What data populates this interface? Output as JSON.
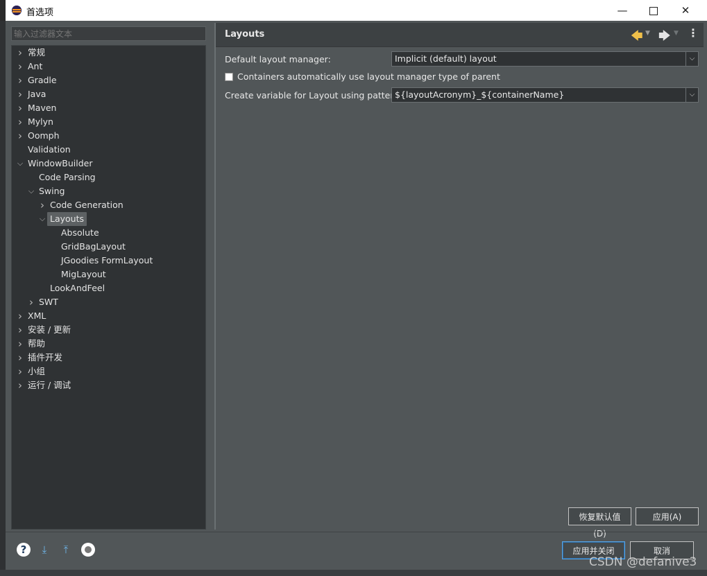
{
  "window": {
    "title": "首选项",
    "minimize_glyph": "—",
    "close_glyph": "✕"
  },
  "filter": {
    "placeholder": "输入过滤器文本"
  },
  "tree": {
    "items": [
      {
        "label": "常规",
        "expander": "collapsed",
        "depth": 0
      },
      {
        "label": "Ant",
        "expander": "collapsed",
        "depth": 0
      },
      {
        "label": "Gradle",
        "expander": "collapsed",
        "depth": 0
      },
      {
        "label": "Java",
        "expander": "collapsed",
        "depth": 0
      },
      {
        "label": "Maven",
        "expander": "collapsed",
        "depth": 0
      },
      {
        "label": "Mylyn",
        "expander": "collapsed",
        "depth": 0
      },
      {
        "label": "Oomph",
        "expander": "collapsed",
        "depth": 0
      },
      {
        "label": "Validation",
        "expander": "none",
        "depth": 0
      },
      {
        "label": "WindowBuilder",
        "expander": "expanded",
        "depth": 0
      },
      {
        "label": "Code Parsing",
        "expander": "none",
        "depth": 1
      },
      {
        "label": "Swing",
        "expander": "expanded",
        "depth": 1
      },
      {
        "label": "Code Generation",
        "expander": "collapsed",
        "depth": 2
      },
      {
        "label": "Layouts",
        "expander": "expanded",
        "depth": 2,
        "selected": true
      },
      {
        "label": "Absolute",
        "expander": "none",
        "depth": 3
      },
      {
        "label": "GridBagLayout",
        "expander": "none",
        "depth": 3
      },
      {
        "label": "JGoodies FormLayout",
        "expander": "none",
        "depth": 3
      },
      {
        "label": "MigLayout",
        "expander": "none",
        "depth": 3
      },
      {
        "label": "LookAndFeel",
        "expander": "none",
        "depth": 2
      },
      {
        "label": "SWT",
        "expander": "collapsed",
        "depth": 1
      },
      {
        "label": "XML",
        "expander": "collapsed",
        "depth": 0
      },
      {
        "label": "安装 / 更新",
        "expander": "collapsed",
        "depth": 0
      },
      {
        "label": "帮助",
        "expander": "collapsed",
        "depth": 0
      },
      {
        "label": "插件开发",
        "expander": "collapsed",
        "depth": 0
      },
      {
        "label": "小组",
        "expander": "collapsed",
        "depth": 0
      },
      {
        "label": "运行 / 调试",
        "expander": "collapsed",
        "depth": 0
      }
    ]
  },
  "page": {
    "title": "Layouts",
    "default_layout_label": "Default layout manager:",
    "default_layout_value": "Implicit (default) layout",
    "containers_checkbox_label": "Containers automatically use layout manager type of parent",
    "containers_checked": false,
    "variable_pattern_label": "Create variable for Layout using pattern:",
    "variable_pattern_value": "${layoutAcronym}_${containerName}",
    "restore_defaults": "恢复默认值(D)",
    "apply": "应用(A)"
  },
  "footer": {
    "apply_and_close": "应用并关闭",
    "cancel": "取消",
    "icons": [
      "help-icon",
      "import-icon",
      "export-icon",
      "record-icon"
    ]
  },
  "watermark": "CSDN @defanive3",
  "colors": {
    "background": "#515658",
    "tree_background": "#2f3234",
    "accent_focus": "#58a6e8",
    "back_arrow": "#f0c04a"
  }
}
